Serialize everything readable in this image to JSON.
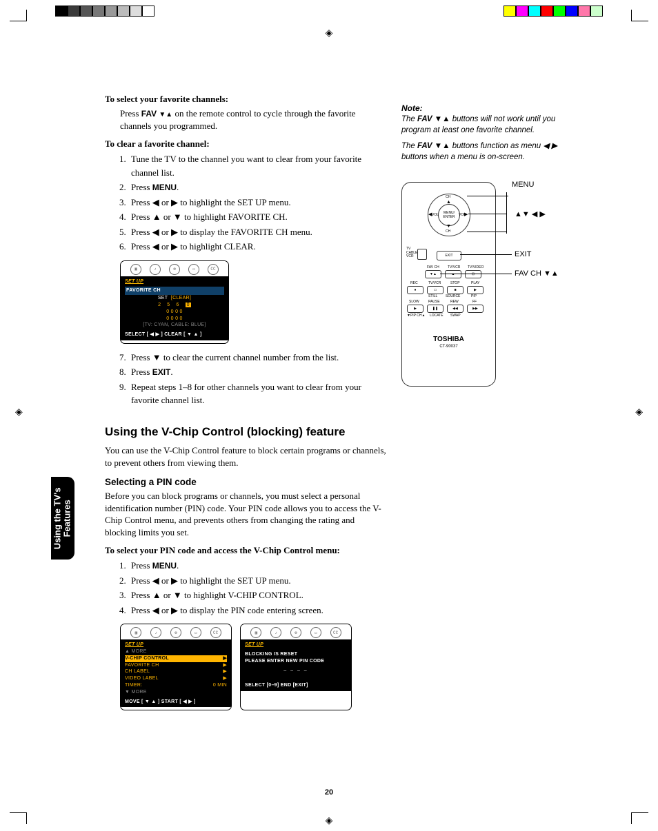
{
  "sidebar": "Using the TV's\nFeatures",
  "page_number": "20",
  "headings": {
    "sel_fav": "To select your favorite channels:",
    "clear_fav": "To clear a favorite channel:",
    "vchip": "Using the V-Chip Control (blocking) feature",
    "sel_pin": "Selecting a PIN code",
    "sel_pin_steps": "To select your PIN code and access the V-Chip Control menu:"
  },
  "fav_press_text_a": "Press ",
  "fav_press_text_b": " on the remote control to cycle through the favorite channels you programmed.",
  "fav_label": "FAV",
  "clear_steps": [
    "Tune the TV to the channel you want to clear from your favorite channel list.",
    "Press MENU.",
    "Press ◀ or ▶ to highlight the SET UP menu.",
    "Press ▲ or ▼ to highlight FAVORITE CH.",
    "Press ◀ or ▶ to display the FAVORITE CH menu.",
    "Press ◀ or ▶ to highlight CLEAR."
  ],
  "clear_steps_2": [
    "Press ▼ to clear the current channel number from the list.",
    "Press EXIT.",
    "Repeat steps 1–8 for other channels you want to clear from your favorite channel list."
  ],
  "vchip_intro": "You can use the V-Chip Control feature to block certain programs or channels, to prevent others from viewing them.",
  "pin_intro": "Before you can block programs or channels, you must select a personal identification number (PIN) code. Your PIN code allows you to access the V-Chip Control menu, and prevents others from changing the rating and blocking limits you set.",
  "pin_steps": [
    "Press MENU.",
    "Press ◀ or ▶ to highlight the SET UP menu.",
    "Press ▲ or ▼ to highlight V-CHIP CONTROL.",
    "Press ◀ or ▶ to display the PIN code entering screen."
  ],
  "note": {
    "head": "Note:",
    "p1a": "The ",
    "p1b": " buttons will not work until you program at least one favorite channel.",
    "p2a": "The ",
    "p2b": " buttons function as menu ◀ ▶ buttons when a menu is on-screen.",
    "fav": "FAV ▼▲"
  },
  "remote_labels": {
    "menu": "MENU",
    "arrows": "▲▼ ◀ ▶",
    "exit": "EXIT",
    "favch": "FAV CH ▼▲"
  },
  "remote_internal": {
    "ch": "CH",
    "vol": "VOL",
    "menu_enter": "MENU/\nENTER",
    "exit": "EXIT",
    "tv": "TV",
    "cable": "CABLE",
    "vcr": "VCR",
    "favch": "FAV CH",
    "tvvcr": "TV/VCR",
    "tvvideo": "TV/VIDEO",
    "rec": "REC",
    "stop": "STOP",
    "play": "PLAY",
    "slow": "SLOW",
    "pause": "PAUSE",
    "rew": "REW",
    "ff": "FF",
    "still": "STILL",
    "source": "SOURCE",
    "pip": "PIP",
    "pipch": "▼PIP CH▲",
    "locate": "LOCATE",
    "swap": "SWAP",
    "brand": "TOSHIBA",
    "model": "CT-90037"
  },
  "screen1": {
    "title": "SET UP",
    "section": "FAVORITE CH",
    "row": "SET  [CLEAR]",
    "grid": [
      "2    5    6    0",
      "0    0    0    0",
      "0    0    0    0"
    ],
    "legend": "[TV: CYAN,  CABLE: BLUE]",
    "footer": "SELECT [ ◀  ▶ ]    CLEAR [ ▼  ▲ ]"
  },
  "screen2": {
    "title": "SET UP",
    "more_up": "▲ MORE",
    "rows": [
      [
        "V-CHIP CONTROL",
        "▶"
      ],
      [
        "FAVORITE CH",
        "▶"
      ],
      [
        "CH LABEL",
        "▶"
      ],
      [
        "VIDEO LABEL",
        "▶"
      ],
      [
        "TIMER:",
        "0 MIN"
      ]
    ],
    "more_down": "▼ MORE",
    "footer": "MOVE [ ▼  ▲ ]     START [ ◀  ▶ ]"
  },
  "screen3": {
    "title": "SET UP",
    "line1": "BLOCKING IS RESET",
    "line2": "PLEASE ENTER NEW PIN CODE",
    "dashes": "– – – –",
    "footer": "SELECT [0–9]   END [EXIT]"
  },
  "colors_left": [
    "#000",
    "#3a3a3a",
    "#555",
    "#777",
    "#999",
    "#bbb",
    "#ddd",
    "#fff"
  ],
  "colors_right": [
    "#ff0",
    "#f0f",
    "#0ff",
    "#f00",
    "#0f0",
    "#00f",
    "#f7a",
    "#cfc"
  ]
}
